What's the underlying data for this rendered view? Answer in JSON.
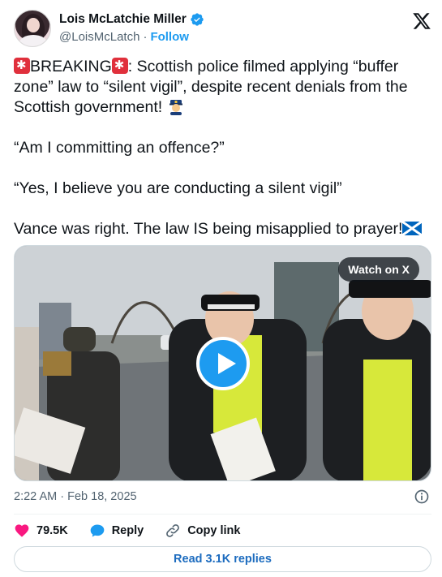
{
  "author": {
    "name": "Lois McLatchie Miller",
    "handle": "@LoisMcLatch",
    "separator": "·",
    "follow_label": "Follow",
    "verified": true
  },
  "tweet": {
    "line1_word": "BREAKING",
    "line1_rest": ": Scottish police filmed applying “buffer zone” law to “silent vigil”, despite recent denials from the Scottish government!",
    "para2": "“Am I committing an offence?”",
    "para3": "“Yes, I believe you are conducting a silent vigil”",
    "para4": "Vance was right. The law IS being misapplied to prayer!"
  },
  "media": {
    "watch_label": "Watch on X",
    "type": "video"
  },
  "meta": {
    "time": "2:22 AM",
    "separator": "·",
    "date": "Feb 18, 2025"
  },
  "actions": {
    "likes_count": "79.5K",
    "reply_label": "Reply",
    "copy_label": "Copy link"
  },
  "replies_label": "Read 3.1K replies",
  "colors": {
    "accent": "#1d9bf0",
    "like": "#f91880",
    "text": "#0f1419",
    "muted": "#536471"
  }
}
